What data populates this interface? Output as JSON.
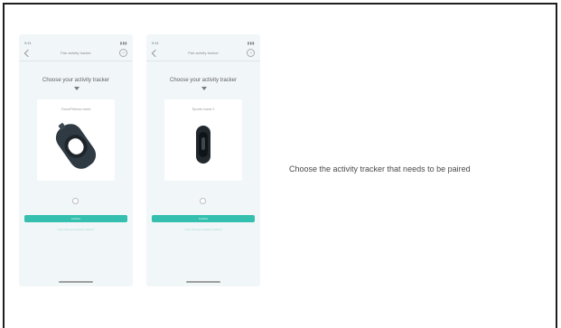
{
  "caption": "Choose the activity tracker that needs to be paired",
  "phones": [
    {
      "status_time": "9:41",
      "status_icons": "▮▮▮",
      "nav_title": "Pair activity tracker",
      "help_icon": "?",
      "heading": "Choose your activity tracker",
      "card_label": "GoodFitness band",
      "device_icon": "round-band-tracker-icon",
      "confirm_label": "Confirm",
      "sublink": "Can't find your activity tracker?"
    },
    {
      "status_time": "9:41",
      "status_icons": "▮▮▮",
      "nav_title": "Pair activity tracker",
      "help_icon": "?",
      "heading": "Choose your activity tracker",
      "card_label": "Sports band 2",
      "device_icon": "slim-band-tracker-icon",
      "confirm_label": "Confirm",
      "sublink": "Can't find your activity tracker?"
    }
  ],
  "colors": {
    "accent": "#35bfae",
    "screen_bg": "#f1f6f8",
    "border": "#1e1e1e",
    "text": "#4a4a4a"
  }
}
